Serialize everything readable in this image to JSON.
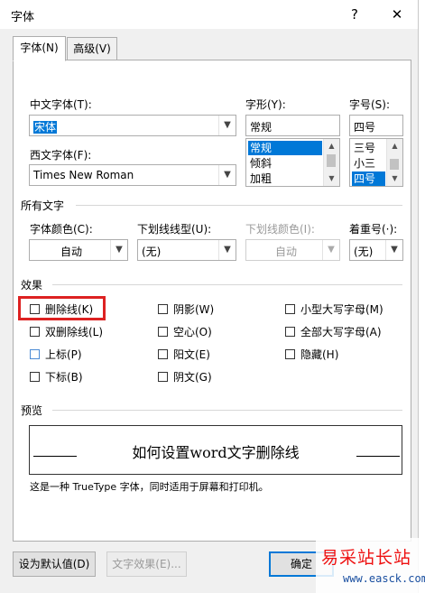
{
  "window": {
    "title": "字体",
    "help_glyph": "?",
    "close_glyph": "✕"
  },
  "tabs": [
    {
      "label": "字体(N)",
      "active": true
    },
    {
      "label": "高级(V)",
      "active": false
    }
  ],
  "font": {
    "chinese_label": "中文字体(T):",
    "chinese_value": "宋体",
    "style_label": "字形(Y):",
    "style_value": "常规",
    "style_options": [
      "常规",
      "倾斜",
      "加粗"
    ],
    "style_selected": "常规",
    "size_label": "字号(S):",
    "size_value": "四号",
    "size_options": [
      "三号",
      "小三",
      "四号"
    ],
    "size_selected": "四号",
    "western_label": "西文字体(F):",
    "western_value": "Times New Roman"
  },
  "all_text": {
    "section_title": "所有文字",
    "color_label": "字体颜色(C):",
    "color_value": "自动",
    "underline_label": "下划线线型(U):",
    "underline_value": "(无)",
    "underline_color_label": "下划线颜色(I):",
    "underline_color_value": "自动",
    "emphasis_label": "着重号(·):",
    "emphasis_value": "(无)"
  },
  "effects": {
    "section_title": "效果",
    "items": [
      {
        "label": "删除线(K)",
        "checked": false
      },
      {
        "label": "阴影(W)",
        "checked": false
      },
      {
        "label": "小型大写字母(M)",
        "checked": false
      },
      {
        "label": "双删除线(L)",
        "checked": false
      },
      {
        "label": "空心(O)",
        "checked": false
      },
      {
        "label": "全部大写字母(A)",
        "checked": false
      },
      {
        "label": "上标(P)",
        "checked": false
      },
      {
        "label": "阳文(E)",
        "checked": false
      },
      {
        "label": "隐藏(H)",
        "checked": false
      },
      {
        "label": "下标(B)",
        "checked": false
      },
      {
        "label": "阴文(G)",
        "checked": false
      }
    ]
  },
  "preview": {
    "section_title": "预览",
    "sample_text": "如何设置word文字删除线",
    "description": "这是一种 TrueType 字体，同时适用于屏幕和打印机。"
  },
  "buttons": {
    "set_default": "设为默认值(D)",
    "text_effects": "文字效果(E)...",
    "ok": "确定"
  },
  "watermark": {
    "title": "易采站长站",
    "url": "www.easck.com"
  },
  "colors": {
    "accent": "#0078d7",
    "highlight_box": "#dd2222",
    "watermark_red": "#ee1111"
  }
}
